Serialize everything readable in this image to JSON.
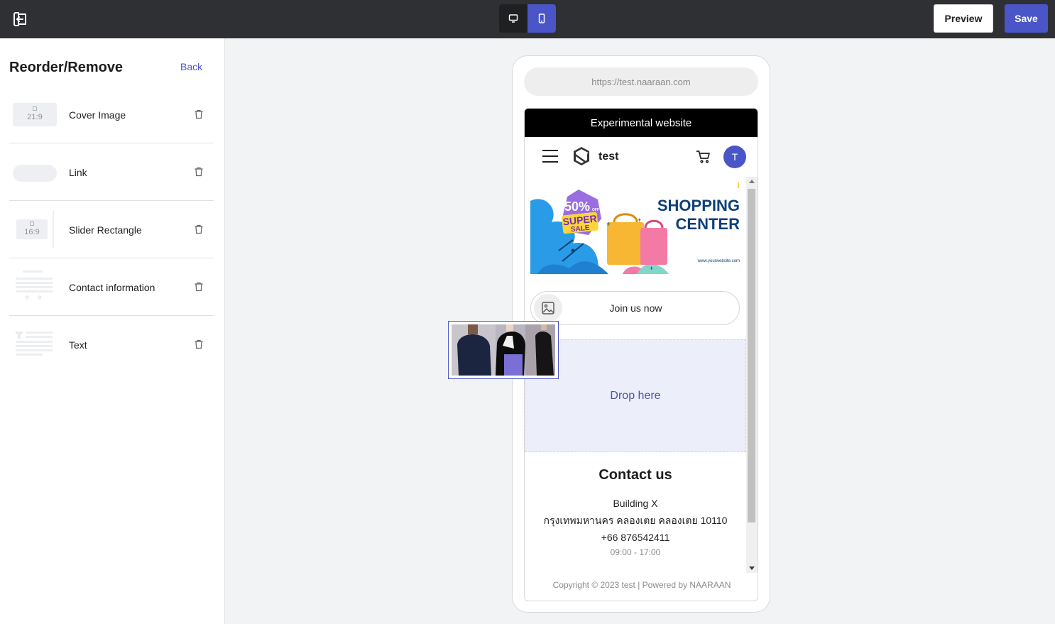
{
  "topbar": {
    "exit_icon": "exit-icon",
    "device_toggle": {
      "desktop_icon": "desktop-icon",
      "mobile_icon": "mobile-icon",
      "active": "mobile"
    },
    "preview_label": "Preview",
    "save_label": "Save",
    "accent_color": "#4a55c7"
  },
  "sidebar": {
    "title": "Reorder/Remove",
    "back_label": "Back",
    "items": [
      {
        "label": "Cover Image",
        "thumb_text": "21:9",
        "trash_icon": "trash-icon"
      },
      {
        "label": "Link",
        "trash_icon": "trash-icon"
      },
      {
        "label": "Slider Rectangle",
        "thumb_text": "16:9",
        "trash_icon": "trash-icon"
      },
      {
        "label": "Contact information",
        "trash_icon": "trash-icon"
      },
      {
        "label": "Text",
        "trash_icon": "trash-icon"
      }
    ]
  },
  "phone": {
    "url": "https://test.naaraan.com",
    "announcement": "Experimental website",
    "brand": "test",
    "avatar_initial": "T",
    "banner": {
      "badge_percent": "50%",
      "badge_off": "OFF",
      "badge_super": "SUPER",
      "badge_sale": "SALE",
      "title_line1": "SHOPPING",
      "title_line2": "CENTER",
      "website": "www.yourwebsite.com"
    },
    "join_label": "Join us now",
    "drop_label": "Drop here",
    "contact": {
      "title": "Contact us",
      "building": "Building X",
      "address": "กรุงเทพมหานคร คลองเตย คลองเตย 10110",
      "phone": "+66 876542411",
      "hours": "09:00 - 17:00"
    },
    "footer": "Copyright © 2023 test | Powered by NAARAAN"
  }
}
